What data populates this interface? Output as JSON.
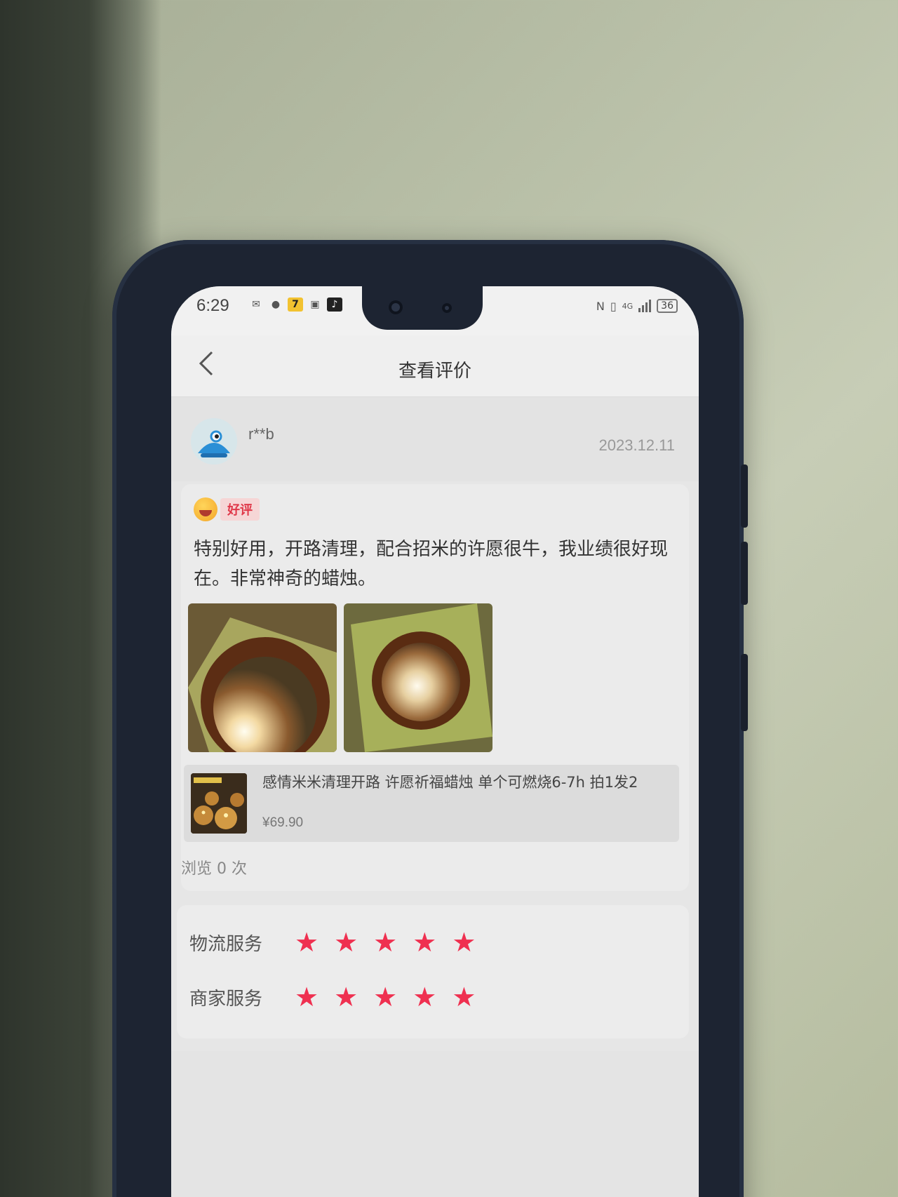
{
  "status_bar": {
    "time": "6:29",
    "battery": "36",
    "network": "4G"
  },
  "header": {
    "back_icon": "chevron-left-icon",
    "title": "查看评价"
  },
  "review": {
    "username": "r**b",
    "date": "2023.12.11",
    "badge": "好评",
    "text": "特别好用，开路清理，配合招米的许愿很牛，我业绩很好现在。非常神奇的蜡烛。",
    "product": {
      "title": "感情米米清理开路 许愿祈福蜡烛 单个可燃烧6-7h 拍1发2",
      "price": "¥69.90"
    },
    "views": "浏览 0 次"
  },
  "ratings": [
    {
      "label": "物流服务",
      "stars": 5
    },
    {
      "label": "商家服务",
      "stars": 5
    }
  ],
  "colors": {
    "star": "#ef3050",
    "badge_text": "#e0394a",
    "badge_bg": "#f6d6d6"
  }
}
